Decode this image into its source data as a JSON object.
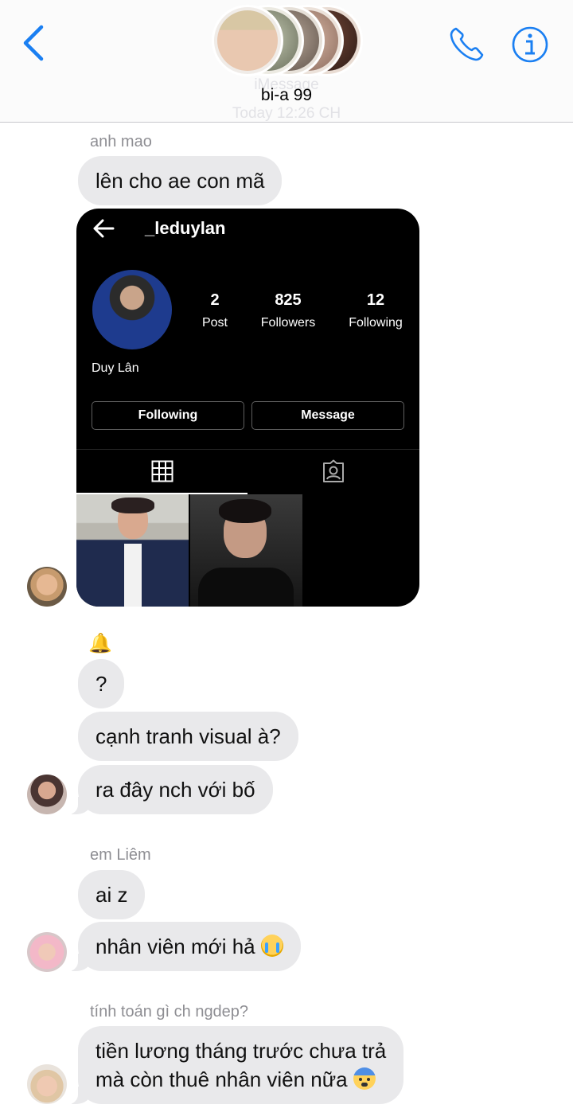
{
  "header": {
    "group_name": "bi-a 99",
    "service_label": "iMessage",
    "timestamp": "Today 12:26 CH",
    "icons": [
      "chevron-left-icon",
      "phone-icon",
      "info-icon"
    ],
    "accent_color": "#1a7ff2"
  },
  "messages": {
    "anh_mao": {
      "sender": "anh mao",
      "text": "lên cho ae con mã"
    },
    "bell": "🔔",
    "q": "?",
    "visual": "cạnh tranh visual à?",
    "nch": "ra đây nch với bố",
    "em_liem": {
      "sender": "em Liêm",
      "text1": "ai z",
      "text2": "nhân viên mới hả"
    },
    "last": {
      "sender": "tính toán gì ch ngdep?",
      "line1": "tiền lương tháng trước chưa trả",
      "line2": "mà còn thuê nhân viên nữa"
    }
  },
  "instagram": {
    "username": "_leduylan",
    "stats": [
      {
        "num": "2",
        "label": "Post"
      },
      {
        "num": "825",
        "label": "Followers"
      },
      {
        "num": "12",
        "label": "Following"
      }
    ],
    "display_name": "Duy Lân",
    "following_button": "Following",
    "message_button": "Message"
  }
}
